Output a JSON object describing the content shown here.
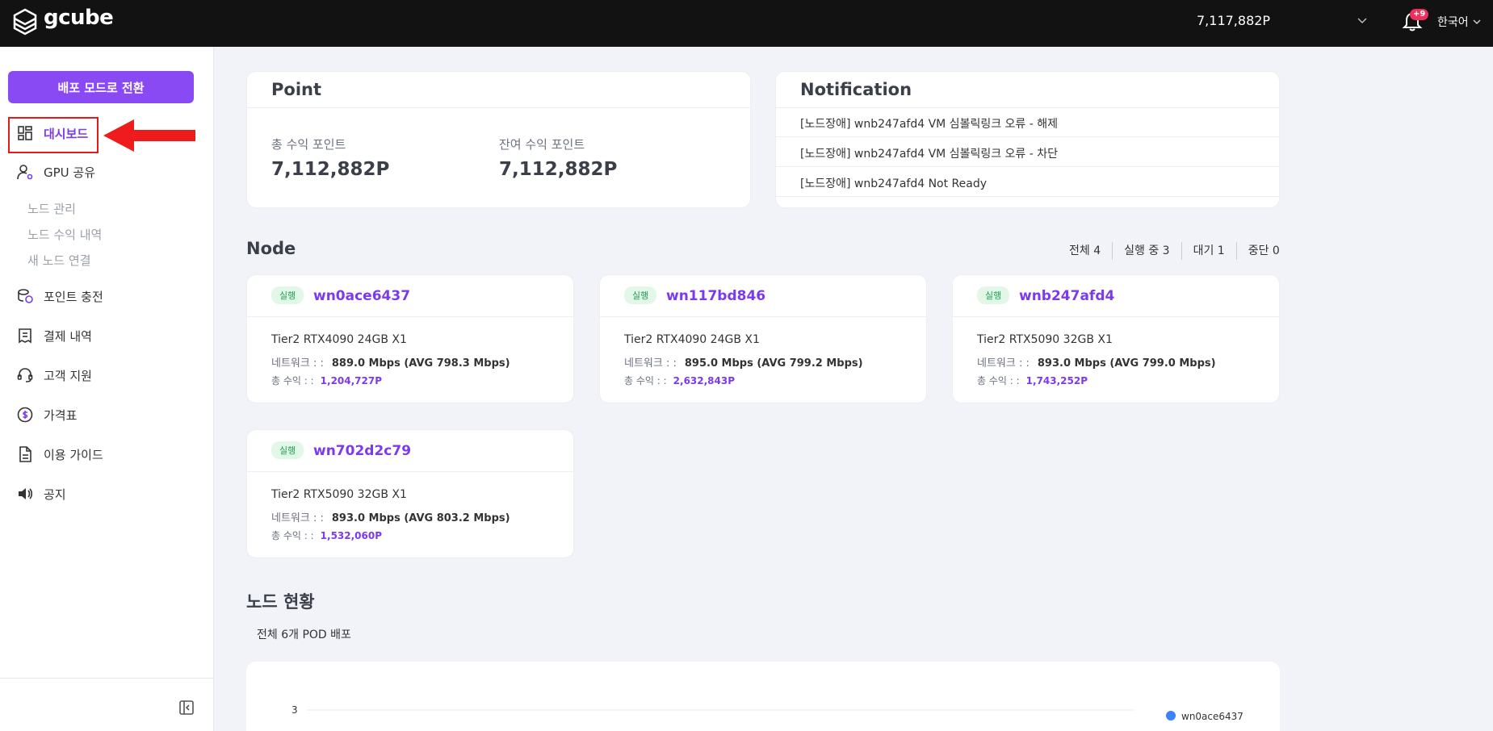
{
  "topbar": {
    "logo_text": "gcube",
    "points": "7,117,882P",
    "notification_badge": "+9",
    "language": "한국어"
  },
  "sidebar": {
    "deploy_button": "배포 모드로 전환",
    "items": {
      "dashboard": "대시보드",
      "gpu_share": "GPU 공유",
      "node_manage": "노드 관리",
      "node_earnings": "노드 수익 내역",
      "new_node": "새 노드 연결",
      "point_charge": "포인트 충전",
      "payment_history": "결제 내역",
      "support": "고객 지원",
      "pricing": "가격표",
      "guide": "이용 가이드",
      "notice": "공지"
    }
  },
  "point_card": {
    "title": "Point",
    "total_label": "총 수익 포인트",
    "total_value": "7,112,882P",
    "remaining_label": "잔여 수익 포인트",
    "remaining_value": "7,112,882P"
  },
  "notification_card": {
    "title": "Notification",
    "items": [
      "[노드장애] wnb247afd4 VM 심볼릭링크 오류 - 해제",
      "[노드장애] wnb247afd4 VM 심볼릭링크 오류 - 차단",
      "[노드장애] wnb247afd4 Not Ready"
    ]
  },
  "node_section": {
    "title": "Node",
    "filters": [
      "전체 4",
      "실행 중 3",
      "대기 1",
      "중단 0"
    ],
    "net_label": "네트워크 : :",
    "earn_label": "총 수익 : :",
    "nodes": [
      {
        "status": "실행",
        "name": "wn0ace6437",
        "tier": "Tier2 RTX4090 24GB X1",
        "network": "889.0 Mbps (AVG 798.3 Mbps)",
        "earnings": "1,204,727P"
      },
      {
        "status": "실행",
        "name": "wn117bd846",
        "tier": "Tier2 RTX4090 24GB X1",
        "network": "895.0 Mbps (AVG 799.2 Mbps)",
        "earnings": "2,632,843P"
      },
      {
        "status": "실행",
        "name": "wnb247afd4",
        "tier": "Tier2 RTX5090 32GB X1",
        "network": "893.0 Mbps (AVG 799.0 Mbps)",
        "earnings": "1,743,252P"
      },
      {
        "status": "실행",
        "name": "wn702d2c79",
        "tier": "Tier2 RTX5090 32GB X1",
        "network": "893.0 Mbps (AVG 803.2 Mbps)",
        "earnings": "1,532,060P"
      }
    ]
  },
  "node_status": {
    "title": "노드 현황",
    "pod_summary": "전체 6개 POD 배포",
    "chart_tick_top": "3",
    "legend_first": "wn0ace6437",
    "legend_color": "#3b82f6"
  },
  "colors": {
    "accent": "#8a4af3",
    "topbar": "#121212",
    "badge": "#ef2f5e",
    "highlight": "#e01b1b"
  }
}
